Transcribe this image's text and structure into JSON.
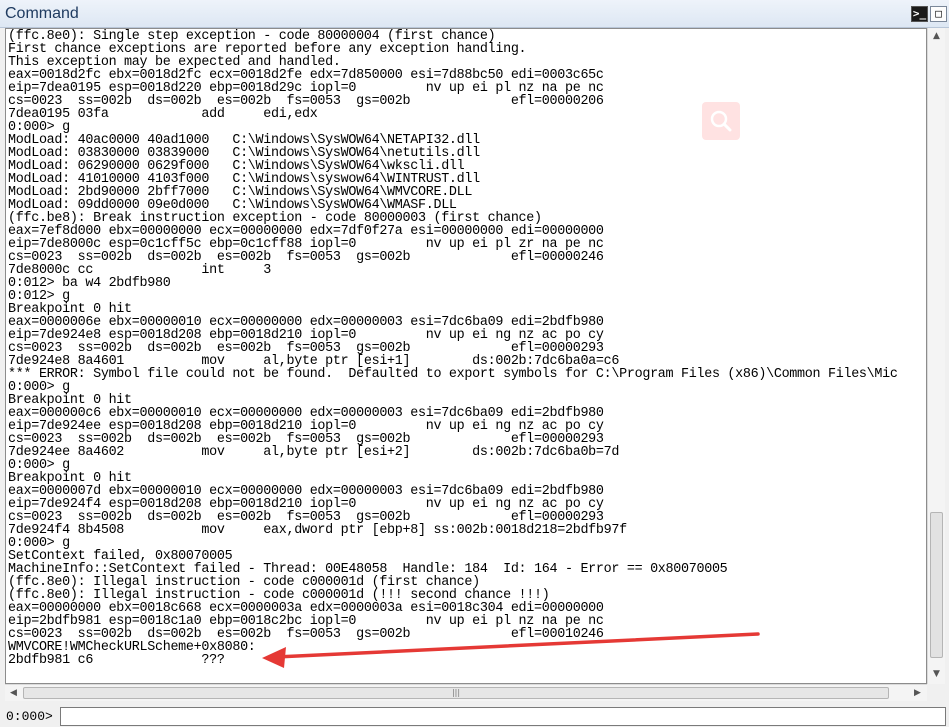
{
  "window": {
    "title": "Command",
    "prompt_button_glyph": ">_",
    "close_glyph": "□"
  },
  "output_lines": [
    "(ffc.8e0): Single step exception - code 80000004 (first chance)",
    "First chance exceptions are reported before any exception handling.",
    "This exception may be expected and handled.",
    "eax=0018d2fc ebx=0018d2fc ecx=0018d2fe edx=7d850000 esi=7d88bc50 edi=0003c65c",
    "eip=7dea0195 esp=0018d220 ebp=0018d29c iopl=0         nv up ei pl nz na pe nc",
    "cs=0023  ss=002b  ds=002b  es=002b  fs=0053  gs=002b             efl=00000206",
    "7dea0195 03fa            add     edi,edx",
    "0:000> g",
    "ModLoad: 40ac0000 40ad1000   C:\\Windows\\SysWOW64\\NETAPI32.dll",
    "ModLoad: 03830000 03839000   C:\\Windows\\SysWOW64\\netutils.dll",
    "ModLoad: 06290000 0629f000   C:\\Windows\\SysWOW64\\wkscli.dll",
    "ModLoad: 41010000 4103f000   C:\\Windows\\syswow64\\WINTRUST.dll",
    "ModLoad: 2bd90000 2bff7000   C:\\Windows\\SysWOW64\\WMVCORE.DLL",
    "ModLoad: 09dd0000 09e0d000   C:\\Windows\\SysWOW64\\WMASF.DLL",
    "(ffc.be8): Break instruction exception - code 80000003 (first chance)",
    "eax=7ef8d000 ebx=00000000 ecx=00000000 edx=7df0f27a esi=00000000 edi=00000000",
    "eip=7de8000c esp=0c1cff5c ebp=0c1cff88 iopl=0         nv up ei pl zr na pe nc",
    "cs=0023  ss=002b  ds=002b  es=002b  fs=0053  gs=002b             efl=00000246",
    "7de8000c cc              int     3",
    "0:012> ba w4 2bdfb980",
    "0:012> g",
    "Breakpoint 0 hit",
    "eax=0000006e ebx=00000010 ecx=00000000 edx=00000003 esi=7dc6ba09 edi=2bdfb980",
    "eip=7de924e8 esp=0018d208 ebp=0018d210 iopl=0         nv up ei ng nz ac po cy",
    "cs=0023  ss=002b  ds=002b  es=002b  fs=0053  gs=002b             efl=00000293",
    "7de924e8 8a4601          mov     al,byte ptr [esi+1]        ds:002b:7dc6ba0a=c6",
    "*** ERROR: Symbol file could not be found.  Defaulted to export symbols for C:\\Program Files (x86)\\Common Files\\Mic",
    "0:000> g",
    "Breakpoint 0 hit",
    "eax=000000c6 ebx=00000010 ecx=00000000 edx=00000003 esi=7dc6ba09 edi=2bdfb980",
    "eip=7de924ee esp=0018d208 ebp=0018d210 iopl=0         nv up ei ng nz ac po cy",
    "cs=0023  ss=002b  ds=002b  es=002b  fs=0053  gs=002b             efl=00000293",
    "7de924ee 8a4602          mov     al,byte ptr [esi+2]        ds:002b:7dc6ba0b=7d",
    "0:000> g",
    "Breakpoint 0 hit",
    "eax=0000007d ebx=00000010 ecx=00000000 edx=00000003 esi=7dc6ba09 edi=2bdfb980",
    "eip=7de924f4 esp=0018d208 ebp=0018d210 iopl=0         nv up ei ng nz ac po cy",
    "cs=0023  ss=002b  ds=002b  es=002b  fs=0053  gs=002b             efl=00000293",
    "7de924f4 8b4508          mov     eax,dword ptr [ebp+8] ss:002b:0018d218=2bdfb97f",
    "0:000> g",
    "SetContext failed, 0x80070005",
    "MachineInfo::SetContext failed - Thread: 00E48058  Handle: 184  Id: 164 - Error == 0x80070005",
    "(ffc.8e0): Illegal instruction - code c000001d (first chance)",
    "(ffc.8e0): Illegal instruction - code c000001d (!!! second chance !!!)",
    "eax=00000000 ebx=0018c668 ecx=0000003a edx=0000003a esi=0018c304 edi=00000000",
    "eip=2bdfb981 esp=0018c1a0 ebp=0018c2bc iopl=0         nv up ei pl nz na pe nc",
    "cs=0023  ss=002b  ds=002b  es=002b  fs=0053  gs=002b             efl=00010246",
    "WMVCORE!WMCheckURLScheme+0x8080:",
    "2bdfb981 c6              ???"
  ],
  "command_bar": {
    "prompt": "0:000>",
    "input_value": ""
  },
  "colors": {
    "annotation_arrow": "#e53935"
  },
  "icons": {
    "overlay": "search-icon",
    "scroll_up": "scroll-up-arrow-icon",
    "scroll_down": "scroll-down-arrow-icon",
    "scroll_left": "scroll-left-arrow-icon",
    "scroll_right": "scroll-right-arrow-icon"
  }
}
